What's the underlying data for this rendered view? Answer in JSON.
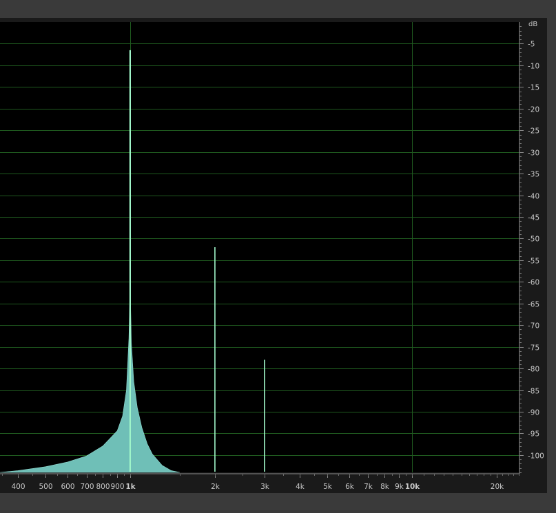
{
  "chart_data": {
    "type": "area",
    "title": "",
    "xscale": "log",
    "xlim": [
      345,
      24000
    ],
    "ylim": [
      -104,
      0
    ],
    "grid": true,
    "unit_label": "dB",
    "x_ticks": [
      {
        "value": 400,
        "label": "400",
        "bold": false
      },
      {
        "value": 500,
        "label": "500",
        "bold": false
      },
      {
        "value": 600,
        "label": "600",
        "bold": false
      },
      {
        "value": 700,
        "label": "700",
        "bold": false
      },
      {
        "value": 800,
        "label": "800",
        "bold": false
      },
      {
        "value": 900,
        "label": "900",
        "bold": false
      },
      {
        "value": 1000,
        "label": "1k",
        "bold": true
      },
      {
        "value": 2000,
        "label": "2k",
        "bold": false
      },
      {
        "value": 3000,
        "label": "3k",
        "bold": false
      },
      {
        "value": 4000,
        "label": "4k",
        "bold": false
      },
      {
        "value": 5000,
        "label": "5k",
        "bold": false
      },
      {
        "value": 6000,
        "label": "6k",
        "bold": false
      },
      {
        "value": 7000,
        "label": "7k",
        "bold": false
      },
      {
        "value": 8000,
        "label": "8k",
        "bold": false
      },
      {
        "value": 9000,
        "label": "9k",
        "bold": false
      },
      {
        "value": 10000,
        "label": "10k",
        "bold": true
      },
      {
        "value": 20000,
        "label": "20k",
        "bold": false
      }
    ],
    "y_ticks": [
      {
        "value": -5,
        "label": "-5"
      },
      {
        "value": -10,
        "label": "-10"
      },
      {
        "value": -15,
        "label": "-15"
      },
      {
        "value": -20,
        "label": "-20"
      },
      {
        "value": -25,
        "label": "-25"
      },
      {
        "value": -30,
        "label": "-30"
      },
      {
        "value": -35,
        "label": "-35"
      },
      {
        "value": -40,
        "label": "-40"
      },
      {
        "value": -45,
        "label": "-45"
      },
      {
        "value": -50,
        "label": "-50"
      },
      {
        "value": -55,
        "label": "-55"
      },
      {
        "value": -60,
        "label": "-60"
      },
      {
        "value": -65,
        "label": "-65"
      },
      {
        "value": -70,
        "label": "-70"
      },
      {
        "value": -75,
        "label": "-75"
      },
      {
        "value": -80,
        "label": "-80"
      },
      {
        "value": -85,
        "label": "-85"
      },
      {
        "value": -90,
        "label": "-90"
      },
      {
        "value": -95,
        "label": "-95"
      },
      {
        "value": -100,
        "label": "-100"
      }
    ],
    "spectrum": {
      "x": [
        345,
        400,
        500,
        600,
        700,
        800,
        900,
        940,
        970,
        990,
        1000,
        1010,
        1030,
        1060,
        1100,
        1150,
        1200,
        1300,
        1400,
        1500
      ],
      "y": [
        -104,
        -103.6,
        -102.7,
        -101.6,
        -100.2,
        -97.9,
        -94.4,
        -91,
        -85,
        -73,
        -60,
        -74,
        -83,
        -89,
        -93.6,
        -97.4,
        -99.8,
        -102.4,
        -103.6,
        -104
      ]
    },
    "peaks": [
      {
        "x": 1000,
        "y": -6.5
      },
      {
        "x": 2000,
        "y": -52
      },
      {
        "x": 3000,
        "y": -78
      }
    ],
    "colors": {
      "fill": "#6fbfb7",
      "peak": "#9ff5c9",
      "grid": "#1f5a1f",
      "plot_bg": "#000000",
      "frame_bg": "#3a3a3a",
      "text": "#c8c8c8"
    }
  }
}
